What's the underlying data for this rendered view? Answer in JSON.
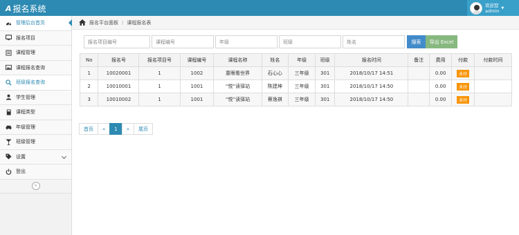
{
  "topbar": {
    "logo": "A",
    "title": "报名系统",
    "user_welcome": "欢迎您",
    "user_name": "admin"
  },
  "sidebar": {
    "items": [
      {
        "label": "管理后台首页",
        "icon": "dashboard-icon"
      },
      {
        "label": "报名项目",
        "icon": "monitor-icon"
      },
      {
        "label": "课程管理",
        "icon": "list-icon"
      },
      {
        "label": "课程报名查询",
        "icon": "picture-icon"
      },
      {
        "label": "班级报名查询",
        "icon": "search-icon"
      },
      {
        "label": "学生管理",
        "icon": "user-icon"
      },
      {
        "label": "课程类型",
        "icon": "book-icon"
      },
      {
        "label": "年级管理",
        "icon": "car-icon"
      },
      {
        "label": "班级管理",
        "icon": "glass-icon"
      },
      {
        "label": "设置",
        "icon": "tag-icon"
      },
      {
        "label": "登出",
        "icon": "power-icon"
      }
    ],
    "collapse_glyph": "«"
  },
  "breadcrumb": {
    "home": "报名平台面板",
    "current": "课程报名表",
    "separator": "/"
  },
  "search": {
    "project_placeholder": "报名项目编号",
    "course_placeholder": "课程编号",
    "grade_placeholder": "年级",
    "class_placeholder": "班级",
    "name_placeholder": "姓名",
    "search_label": "搜索",
    "excel_label": "导出 Excel"
  },
  "table": {
    "headers": [
      "No",
      "报名号",
      "报名项目号",
      "课程编号",
      "课程名称",
      "姓名",
      "年级",
      "班级",
      "报名时间",
      "备注",
      "费用",
      "付款",
      "付款时间"
    ],
    "rows": [
      {
        "no": "1",
        "reg_no": "10020001",
        "project_no": "1",
        "course_no": "1002",
        "course_name": "童眼看世界",
        "name": "石心心",
        "grade": "三年级",
        "class": "301",
        "reg_time": "2018/10/17 14:51",
        "note": "",
        "fee": "0.00",
        "paid": "未付",
        "paid_time": ""
      },
      {
        "no": "2",
        "reg_no": "10010001",
        "project_no": "1",
        "course_no": "1001",
        "course_name": "“悦”读驿站",
        "name": "陈建坤",
        "grade": "三年级",
        "class": "301",
        "reg_time": "2018/10/17 14:50",
        "note": "",
        "fee": "0.00",
        "paid": "未付",
        "paid_time": ""
      },
      {
        "no": "3",
        "reg_no": "10010002",
        "project_no": "1",
        "course_no": "1001",
        "course_name": "“悦”读驿站",
        "name": "蔡逸祺",
        "grade": "三年级",
        "class": "301",
        "reg_time": "2018/10/17 14:50",
        "note": "",
        "fee": "0.00",
        "paid": "未付",
        "paid_time": ""
      }
    ]
  },
  "pagination": {
    "first": "首页",
    "prev": "«",
    "current": "1",
    "next": "»",
    "last": "尾页"
  },
  "colors": {
    "brand": "#2d8ab2",
    "unpaid_badge": "#f89406",
    "excel_button": "#87b87f",
    "search_button": "#428bca"
  }
}
